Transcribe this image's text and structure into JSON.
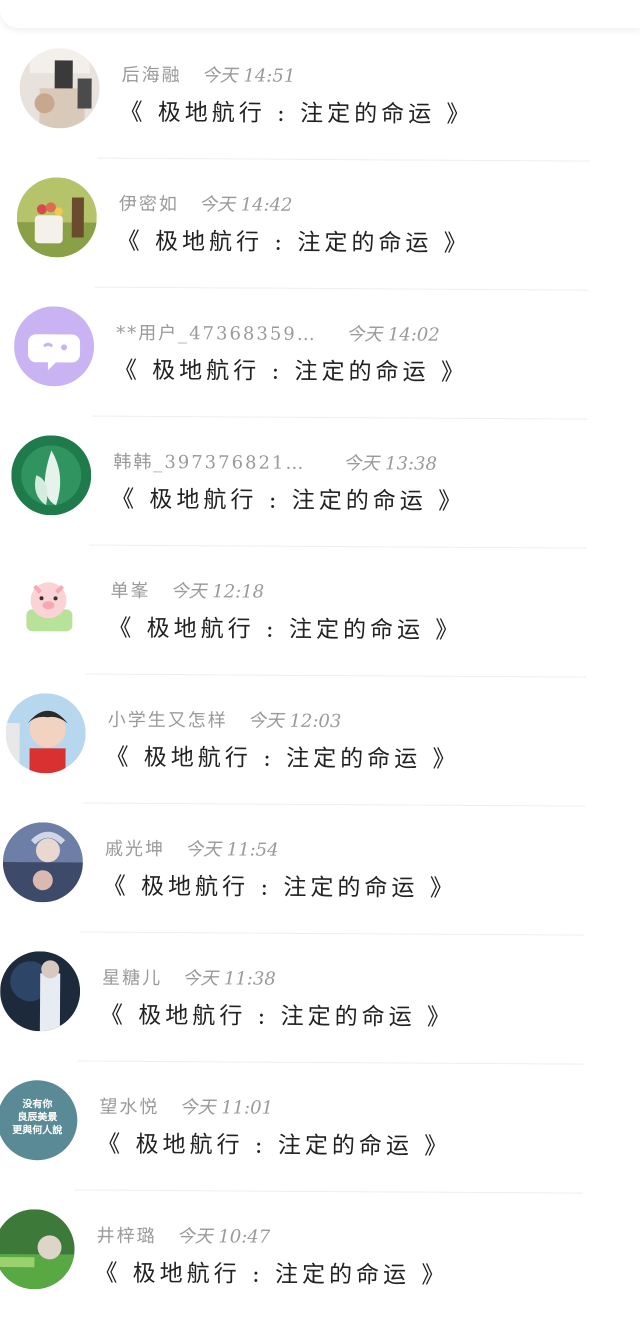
{
  "comments": [
    {
      "user": "后海融",
      "time": "今天 14:51",
      "text": "《 极地航行 : 注定的命运 》",
      "avatar": "photo-avatar"
    },
    {
      "user": "伊密如",
      "time": "今天 14:42",
      "text": "《 极地航行 : 注定的命运 》",
      "avatar": "flower-avatar"
    },
    {
      "user": "**用户_47368359492...",
      "time": "今天 14:02",
      "text": "《 极地航行 : 注定的命运 》",
      "avatar": "default-chat-avatar"
    },
    {
      "user": "韩韩_3973768215261...",
      "time": "今天 13:38",
      "text": "《 极地航行 : 注定的命运 》",
      "avatar": "plant-avatar"
    },
    {
      "user": "单峯",
      "time": "今天 12:18",
      "text": "《 极地航行 : 注定的命运 》",
      "avatar": "pig-avatar"
    },
    {
      "user": "小学生又怎样",
      "time": "今天 12:03",
      "text": "《 极地航行 : 注定的命运 》",
      "avatar": "person-avatar"
    },
    {
      "user": "戚光坤",
      "time": "今天 11:54",
      "text": "《 极地航行 : 注定的命运 》",
      "avatar": "anime-avatar"
    },
    {
      "user": "星糖儿",
      "time": "今天 11:38",
      "text": "《 极地航行 : 注定的命运 》",
      "avatar": "night-avatar"
    },
    {
      "user": "望水悦",
      "time": "今天 11:01",
      "text": "《 极地航行 : 注定的命运 》",
      "avatar": "text-avatar",
      "avatar_text": [
        "没有你",
        "良辰美景",
        "更與何人說"
      ]
    },
    {
      "user": "井梓璐",
      "time": "今天 10:47",
      "text": "《 极地航行 : 注定的命运 》",
      "avatar": "green-avatar"
    }
  ],
  "colors": {
    "background": "#ffffff",
    "username": "#9a9a9a",
    "content": "#222222",
    "divider": "#eeeeee",
    "default_avatar": "#c9b3f3"
  }
}
